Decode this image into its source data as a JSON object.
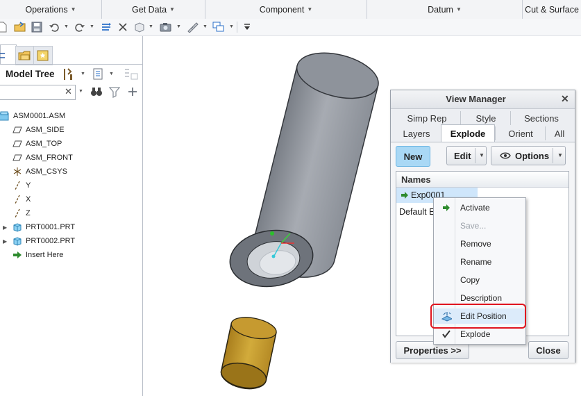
{
  "ribbon": {
    "groups": [
      "Operations",
      "Get Data",
      "Component",
      "Datum",
      "Cut & Surface"
    ]
  },
  "model_tree": {
    "title": "Model Tree",
    "search_value": "",
    "items": [
      {
        "label": "ASM0001.ASM",
        "icon": "assembly-icon"
      },
      {
        "label": "ASM_SIDE",
        "icon": "datum-plane-icon"
      },
      {
        "label": "ASM_TOP",
        "icon": "datum-plane-icon"
      },
      {
        "label": "ASM_FRONT",
        "icon": "datum-plane-icon"
      },
      {
        "label": "ASM_CSYS",
        "icon": "coordinate-system-icon"
      },
      {
        "label": "Y",
        "icon": "axis-icon"
      },
      {
        "label": "X",
        "icon": "axis-icon"
      },
      {
        "label": "Z",
        "icon": "axis-icon"
      },
      {
        "label": "PRT0001.PRT",
        "icon": "part-icon"
      },
      {
        "label": "PRT0002.PRT",
        "icon": "part-icon"
      },
      {
        "label": "Insert Here",
        "icon": "insert-arrow-icon"
      }
    ]
  },
  "view_manager": {
    "title": "View Manager",
    "tabs_row1": [
      "Simp Rep",
      "Style",
      "Sections"
    ],
    "tabs_row2": [
      "Layers",
      "Explode",
      "Orient",
      "All"
    ],
    "active_tab": "Explode",
    "new_label": "New",
    "edit_label": "Edit",
    "options_label": "Options",
    "column_header": "Names",
    "rows": [
      "Exp0001",
      "Default E"
    ],
    "properties_label": "Properties >>",
    "close_label": "Close"
  },
  "context_menu": {
    "items": [
      "Activate",
      "Save...",
      "Remove",
      "Rename",
      "Copy",
      "Description",
      "Edit Position",
      "Explode"
    ],
    "highlighted": "Edit Position",
    "checked": "Explode",
    "disabled": "Save..."
  },
  "colors": {
    "highlight_box": "#e0141e",
    "new_button": "#a9d8f5",
    "selected_row": "#cfe6fb",
    "part_gray": "#a7abb2",
    "part_gold": "#c8a133"
  }
}
